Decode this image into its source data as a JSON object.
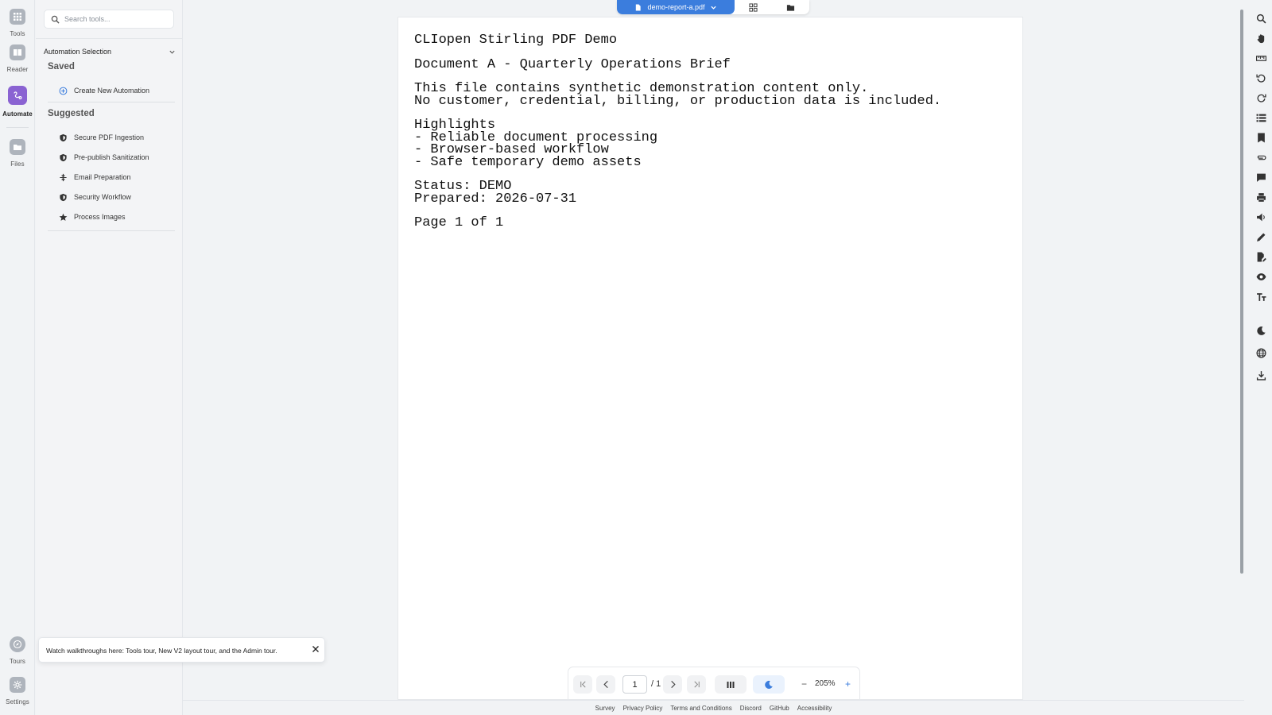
{
  "rail": {
    "items": [
      {
        "label": "Tools",
        "icon": "grid-icon"
      },
      {
        "label": "Reader",
        "icon": "reader-icon"
      },
      {
        "label": "Automate",
        "icon": "automate-icon",
        "active": true
      },
      {
        "label": "Files",
        "icon": "folder-icon"
      }
    ],
    "bottom_items": [
      {
        "label": "Tours",
        "icon": "compass-icon"
      },
      {
        "label": "Settings",
        "icon": "gear-icon"
      }
    ]
  },
  "panel": {
    "search_placeholder": "Search tools...",
    "selection_header": "Automation Selection",
    "saved_title": "Saved",
    "create_label": "Create New Automation",
    "suggested_title": "Suggested",
    "suggested": [
      {
        "label": "Secure PDF Ingestion",
        "icon": "shield-icon"
      },
      {
        "label": "Pre-publish Sanitization",
        "icon": "shield-icon"
      },
      {
        "label": "Email Preparation",
        "icon": "compress-icon"
      },
      {
        "label": "Security Workflow",
        "icon": "shield-icon"
      },
      {
        "label": "Process Images",
        "icon": "star-icon"
      }
    ]
  },
  "topbar": {
    "file_name": "demo-report-a.pdf"
  },
  "document": {
    "lines": [
      "CLIopen Stirling PDF Demo",
      "",
      "Document A - Quarterly Operations Brief",
      "",
      "This file contains synthetic demonstration content only.",
      "No customer, credential, billing, or production data is included.",
      "",
      "Highlights",
      "- Reliable document processing",
      "- Browser-based workflow",
      "- Safe temporary demo assets",
      "",
      "Status: DEMO",
      "Prepared: 2026-07-31",
      "",
      "Page 1 of 1"
    ]
  },
  "nav": {
    "current_page": "1",
    "total_pages": "/ 1",
    "zoom": "205%",
    "zoom_minus": "−",
    "zoom_plus": "+"
  },
  "footer": {
    "links": [
      "Survey",
      "Privacy Policy",
      "Terms and Conditions",
      "Discord",
      "GitHub",
      "Accessibility"
    ]
  },
  "toast": {
    "text": "Watch walkthroughs here: Tools tour, New V2 layout tour, and the Admin tour."
  },
  "colors": {
    "accent": "#3b7ddd",
    "automate_active": "#8a63d2"
  }
}
